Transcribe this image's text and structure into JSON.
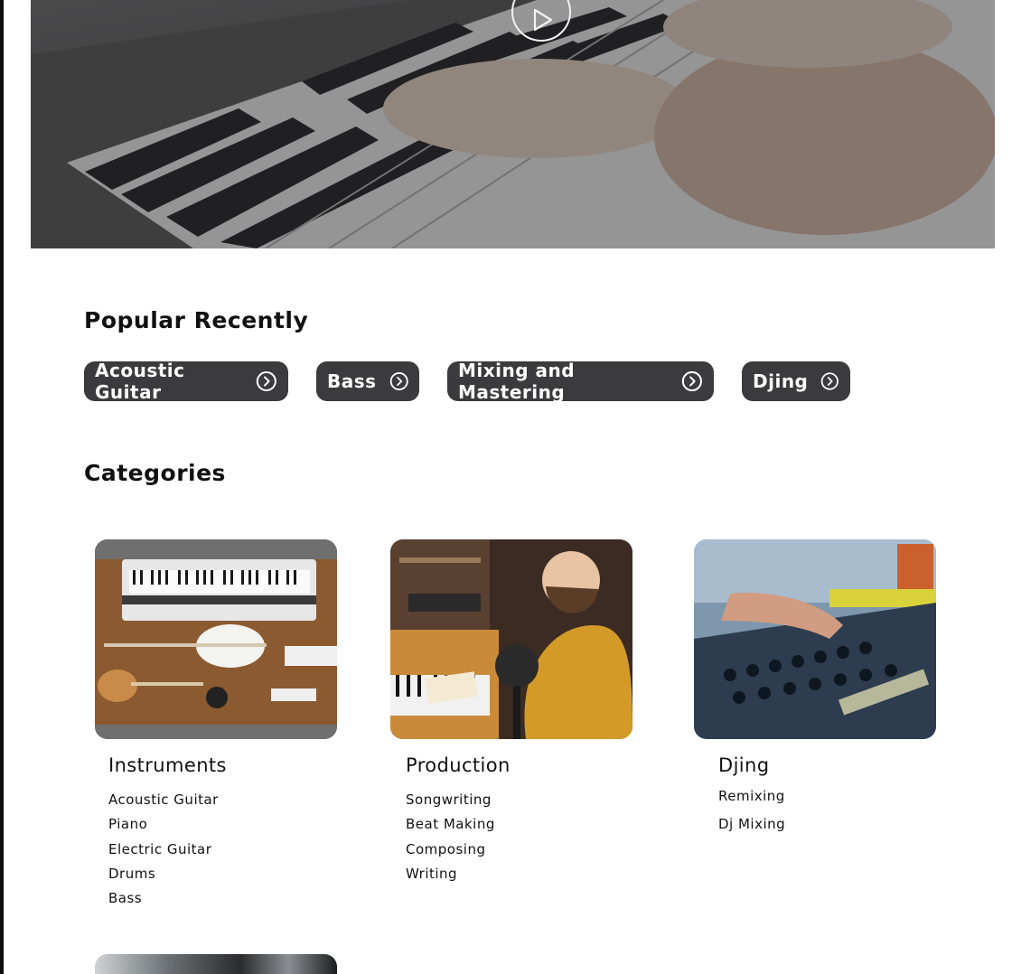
{
  "hero": {
    "play_icon": "play-icon",
    "background": "piano-keys-photo"
  },
  "popular": {
    "title": "Popular Recently",
    "items": [
      {
        "label": "Acoustic Guitar",
        "icon": "chevron-right-circle-icon"
      },
      {
        "label": "Bass",
        "icon": "chevron-right-circle-icon"
      },
      {
        "label": "Mixing and Mastering",
        "icon": "chevron-right-circle-icon"
      },
      {
        "label": "Djing",
        "icon": "chevron-right-circle-icon"
      }
    ]
  },
  "categories": {
    "title": "Categories",
    "cards": [
      {
        "title": "Instruments",
        "image": "instruments-flatlay-photo",
        "links": [
          "Acoustic Guitar",
          "Piano",
          "Electric Guitar",
          "Drums",
          "Bass"
        ]
      },
      {
        "title": "Production",
        "image": "producer-writing-photo",
        "links": [
          "Songwriting",
          "Beat Making",
          "Composing",
          "Writing"
        ]
      },
      {
        "title": "Djing",
        "image": "dj-mixer-photo",
        "links": [
          "Remixing",
          "Dj Mixing"
        ]
      }
    ]
  },
  "colors": {
    "pill_bg": "#3b3b3d",
    "pill_text": "#ffffff",
    "text": "#111111",
    "hero_dark": "#3a3a3c"
  }
}
